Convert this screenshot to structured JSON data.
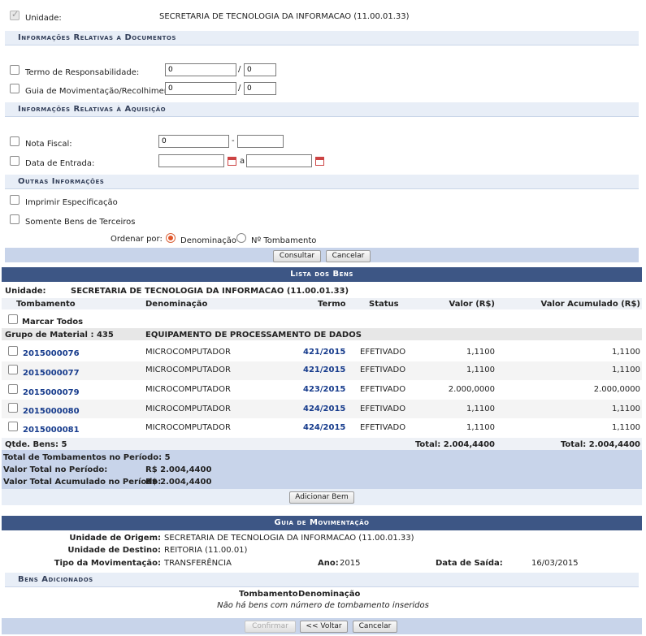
{
  "unidade": {
    "label": "Unidade:",
    "value": "SECRETARIA DE TECNOLOGIA DA INFORMACAO (11.00.01.33)"
  },
  "doc_section": {
    "title": "Informações Relativas a Documentos",
    "termo_label": "Termo de Responsabilidade:",
    "termo_a": "0",
    "termo_sep": "/",
    "termo_b": "0",
    "guia_label": "Guia de Movimentação/Recolhimento:",
    "guia_a": "0",
    "guia_sep": "/",
    "guia_b": "0"
  },
  "aq_section": {
    "title": "Informações Relativas à Aquisição",
    "nf_label": "Nota Fiscal:",
    "nf_a": "0",
    "nf_sep": "-",
    "nf_b": "",
    "data_label": "Data de Entrada:",
    "data_a": "",
    "data_sep": "a",
    "data_b": ""
  },
  "outras": {
    "title": "Outras Informações",
    "imprimir": "Imprimir Especificação",
    "terceiros": "Somente Bens de Terceiros",
    "ordenar": "Ordenar por:",
    "opt1": "Denominação",
    "opt2": "Nº Tombamento"
  },
  "search_buttons": {
    "consultar": "Consultar",
    "cancelar": "Cancelar"
  },
  "lista": {
    "title": "Lista dos Bens",
    "unidade_label": "Unidade:",
    "unidade_value": "SECRETARIA DE TECNOLOGIA DA INFORMACAO (11.00.01.33)",
    "headers": {
      "tombamento": "Tombamento",
      "denominacao": "Denominação",
      "termo": "Termo",
      "status": "Status",
      "valor": "Valor (R$)",
      "acumulado": "Valor Acumulado (R$)"
    },
    "marcar_todos": "Marcar Todos",
    "grupo_label": "Grupo de Material : 435",
    "grupo_value": "EQUIPAMENTO DE PROCESSAMENTO DE DADOS",
    "rows": [
      {
        "tomb": "2015000076",
        "denom": "MICROCOMPUTADOR",
        "termo": "421/2015",
        "status": "EFETIVADO",
        "valor": "1,1100",
        "acum": "1,1100"
      },
      {
        "tomb": "2015000077",
        "denom": "MICROCOMPUTADOR",
        "termo": "421/2015",
        "status": "EFETIVADO",
        "valor": "1,1100",
        "acum": "1,1100"
      },
      {
        "tomb": "2015000079",
        "denom": "MICROCOMPUTADOR",
        "termo": "423/2015",
        "status": "EFETIVADO",
        "valor": "2.000,0000",
        "acum": "2.000,0000"
      },
      {
        "tomb": "2015000080",
        "denom": "MICROCOMPUTADOR",
        "termo": "424/2015",
        "status": "EFETIVADO",
        "valor": "1,1100",
        "acum": "1,1100"
      },
      {
        "tomb": "2015000081",
        "denom": "MICROCOMPUTADOR",
        "termo": "424/2015",
        "status": "EFETIVADO",
        "valor": "1,1100",
        "acum": "1,1100"
      }
    ],
    "qtde": "Qtde. Bens: 5",
    "total_valor": "Total: 2.004,4400",
    "total_acum": "Total: 2.004,4400",
    "total_tomb": "Total de Tombamentos no Período: 5",
    "valor_total_label": "Valor Total no Período:",
    "valor_total": "R$ 2.004,4400",
    "valor_acum_label": "Valor Total Acumulado no Período:",
    "valor_acum": "R$ 2.004,4400",
    "adicionar": "Adicionar Bem"
  },
  "guia": {
    "title": "Guia de Movimentação",
    "origem_label": "Unidade de Origem:",
    "origem": "SECRETARIA DE TECNOLOGIA DA INFORMACAO (11.00.01.33)",
    "destino_label": "Unidade de Destino:",
    "destino": "REITORIA (11.00.01)",
    "tipo_label": "Tipo da Movimentação:",
    "tipo": "TRANSFERÊNCIA",
    "ano_label": "Ano:",
    "ano": "2015",
    "saida_label": "Data de Saída:",
    "saida": "16/03/2015",
    "bens_title": "Bens Adicionados",
    "col_tomb": "Tombamento",
    "col_denom": "Denominação",
    "empty": "Não há bens com número de tombamento inseridos"
  },
  "footer": {
    "confirmar": "Confirmar",
    "voltar": "<< Voltar",
    "cancelar": "Cancelar"
  }
}
